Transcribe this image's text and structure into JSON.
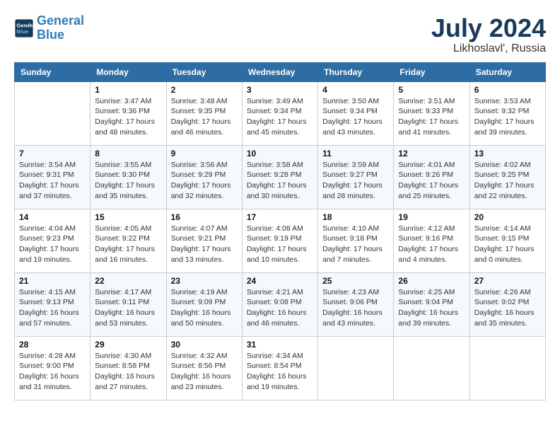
{
  "header": {
    "logo_line1": "General",
    "logo_line2": "Blue",
    "month": "July 2024",
    "location": "Likhoslavl', Russia"
  },
  "weekdays": [
    "Sunday",
    "Monday",
    "Tuesday",
    "Wednesday",
    "Thursday",
    "Friday",
    "Saturday"
  ],
  "weeks": [
    [
      {
        "day": "",
        "info": ""
      },
      {
        "day": "1",
        "info": "Sunrise: 3:47 AM\nSunset: 9:36 PM\nDaylight: 17 hours\nand 48 minutes."
      },
      {
        "day": "2",
        "info": "Sunrise: 3:48 AM\nSunset: 9:35 PM\nDaylight: 17 hours\nand 46 minutes."
      },
      {
        "day": "3",
        "info": "Sunrise: 3:49 AM\nSunset: 9:34 PM\nDaylight: 17 hours\nand 45 minutes."
      },
      {
        "day": "4",
        "info": "Sunrise: 3:50 AM\nSunset: 9:34 PM\nDaylight: 17 hours\nand 43 minutes."
      },
      {
        "day": "5",
        "info": "Sunrise: 3:51 AM\nSunset: 9:33 PM\nDaylight: 17 hours\nand 41 minutes."
      },
      {
        "day": "6",
        "info": "Sunrise: 3:53 AM\nSunset: 9:32 PM\nDaylight: 17 hours\nand 39 minutes."
      }
    ],
    [
      {
        "day": "7",
        "info": "Sunrise: 3:54 AM\nSunset: 9:31 PM\nDaylight: 17 hours\nand 37 minutes."
      },
      {
        "day": "8",
        "info": "Sunrise: 3:55 AM\nSunset: 9:30 PM\nDaylight: 17 hours\nand 35 minutes."
      },
      {
        "day": "9",
        "info": "Sunrise: 3:56 AM\nSunset: 9:29 PM\nDaylight: 17 hours\nand 32 minutes."
      },
      {
        "day": "10",
        "info": "Sunrise: 3:58 AM\nSunset: 9:28 PM\nDaylight: 17 hours\nand 30 minutes."
      },
      {
        "day": "11",
        "info": "Sunrise: 3:59 AM\nSunset: 9:27 PM\nDaylight: 17 hours\nand 28 minutes."
      },
      {
        "day": "12",
        "info": "Sunrise: 4:01 AM\nSunset: 9:26 PM\nDaylight: 17 hours\nand 25 minutes."
      },
      {
        "day": "13",
        "info": "Sunrise: 4:02 AM\nSunset: 9:25 PM\nDaylight: 17 hours\nand 22 minutes."
      }
    ],
    [
      {
        "day": "14",
        "info": "Sunrise: 4:04 AM\nSunset: 9:23 PM\nDaylight: 17 hours\nand 19 minutes."
      },
      {
        "day": "15",
        "info": "Sunrise: 4:05 AM\nSunset: 9:22 PM\nDaylight: 17 hours\nand 16 minutes."
      },
      {
        "day": "16",
        "info": "Sunrise: 4:07 AM\nSunset: 9:21 PM\nDaylight: 17 hours\nand 13 minutes."
      },
      {
        "day": "17",
        "info": "Sunrise: 4:08 AM\nSunset: 9:19 PM\nDaylight: 17 hours\nand 10 minutes."
      },
      {
        "day": "18",
        "info": "Sunrise: 4:10 AM\nSunset: 9:18 PM\nDaylight: 17 hours\nand 7 minutes."
      },
      {
        "day": "19",
        "info": "Sunrise: 4:12 AM\nSunset: 9:16 PM\nDaylight: 17 hours\nand 4 minutes."
      },
      {
        "day": "20",
        "info": "Sunrise: 4:14 AM\nSunset: 9:15 PM\nDaylight: 17 hours\nand 0 minutes."
      }
    ],
    [
      {
        "day": "21",
        "info": "Sunrise: 4:15 AM\nSunset: 9:13 PM\nDaylight: 16 hours\nand 57 minutes."
      },
      {
        "day": "22",
        "info": "Sunrise: 4:17 AM\nSunset: 9:11 PM\nDaylight: 16 hours\nand 53 minutes."
      },
      {
        "day": "23",
        "info": "Sunrise: 4:19 AM\nSunset: 9:09 PM\nDaylight: 16 hours\nand 50 minutes."
      },
      {
        "day": "24",
        "info": "Sunrise: 4:21 AM\nSunset: 9:08 PM\nDaylight: 16 hours\nand 46 minutes."
      },
      {
        "day": "25",
        "info": "Sunrise: 4:23 AM\nSunset: 9:06 PM\nDaylight: 16 hours\nand 43 minutes."
      },
      {
        "day": "26",
        "info": "Sunrise: 4:25 AM\nSunset: 9:04 PM\nDaylight: 16 hours\nand 39 minutes."
      },
      {
        "day": "27",
        "info": "Sunrise: 4:26 AM\nSunset: 9:02 PM\nDaylight: 16 hours\nand 35 minutes."
      }
    ],
    [
      {
        "day": "28",
        "info": "Sunrise: 4:28 AM\nSunset: 9:00 PM\nDaylight: 16 hours\nand 31 minutes."
      },
      {
        "day": "29",
        "info": "Sunrise: 4:30 AM\nSunset: 8:58 PM\nDaylight: 16 hours\nand 27 minutes."
      },
      {
        "day": "30",
        "info": "Sunrise: 4:32 AM\nSunset: 8:56 PM\nDaylight: 16 hours\nand 23 minutes."
      },
      {
        "day": "31",
        "info": "Sunrise: 4:34 AM\nSunset: 8:54 PM\nDaylight: 16 hours\nand 19 minutes."
      },
      {
        "day": "",
        "info": ""
      },
      {
        "day": "",
        "info": ""
      },
      {
        "day": "",
        "info": ""
      }
    ]
  ]
}
